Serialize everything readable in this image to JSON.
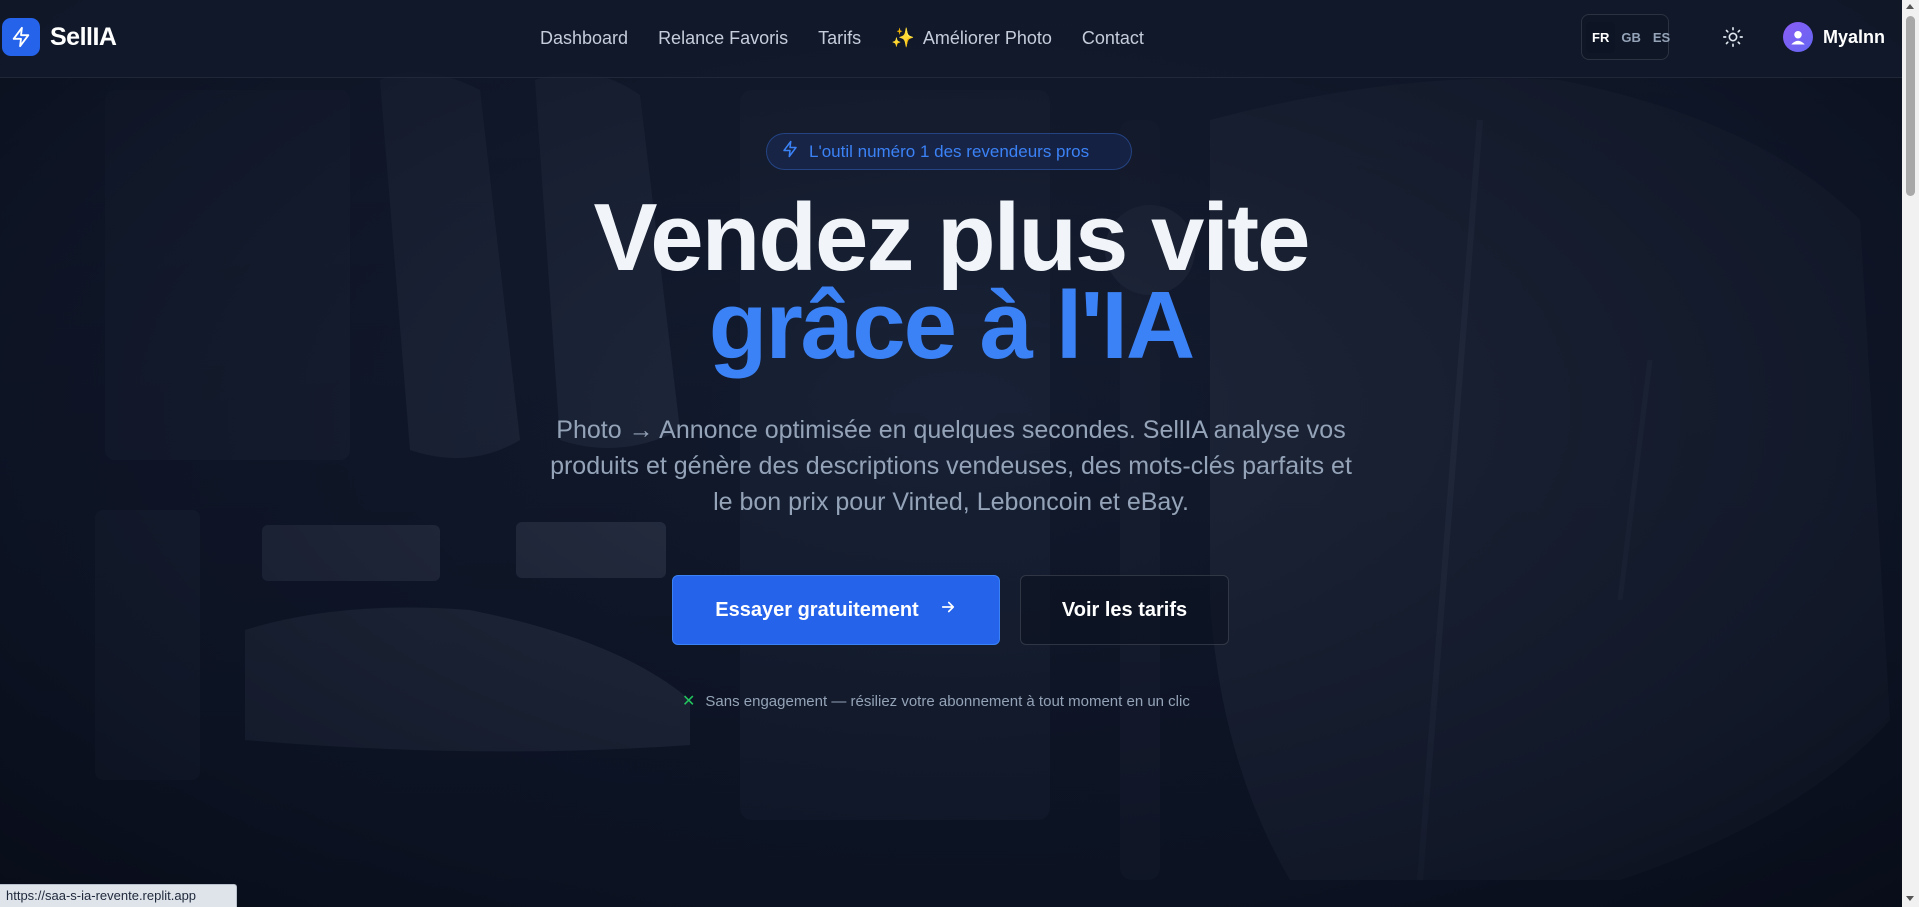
{
  "colors": {
    "accent": "#2563eb",
    "accent_text": "#3b82f6",
    "background": "#0b1222",
    "success": "#22c55e"
  },
  "navbar": {
    "brand": {
      "name": "SellIA",
      "logo_icon": "lightning-icon"
    },
    "links": [
      {
        "label": "Dashboard"
      },
      {
        "label": "Relance Favoris"
      },
      {
        "label": "Tarifs"
      },
      {
        "label": "Améliorer Photo",
        "icon": "sparkles-icon",
        "glyph": "✨"
      },
      {
        "label": "Contact"
      }
    ],
    "languages": [
      {
        "code": "FR",
        "active": true
      },
      {
        "code": "GB",
        "active": false
      },
      {
        "code": "ES",
        "active": false
      }
    ],
    "theme_toggle_icon": "sun-icon",
    "user": {
      "name": "Myalnn",
      "avatar_icon": "user-icon"
    }
  },
  "hero": {
    "badge": {
      "icon": "lightning-icon",
      "text": "L'outil numéro 1 des revendeurs pros"
    },
    "title_line1": "Vendez plus vite",
    "title_line2": "grâce à l'IA",
    "subtitle": "Photo → Annonce optimisée en quelques secondes. SellIA analyse vos produits et génère des descriptions vendeuses, des mots-clés parfaits et le bon prix pour Vinted, Leboncoin et eBay.",
    "primary_cta": {
      "label": "Essayer gratuitement",
      "icon": "arrow-right-icon"
    },
    "secondary_cta": {
      "label": "Voir les tarifs"
    },
    "guarantee": {
      "icon": "check-icon",
      "glyph": "✕",
      "text": "Sans engagement — résiliez votre abonnement à tout moment en un clic"
    }
  },
  "browser": {
    "status_url": "https://saa-s-ia-revente.replit.app"
  }
}
